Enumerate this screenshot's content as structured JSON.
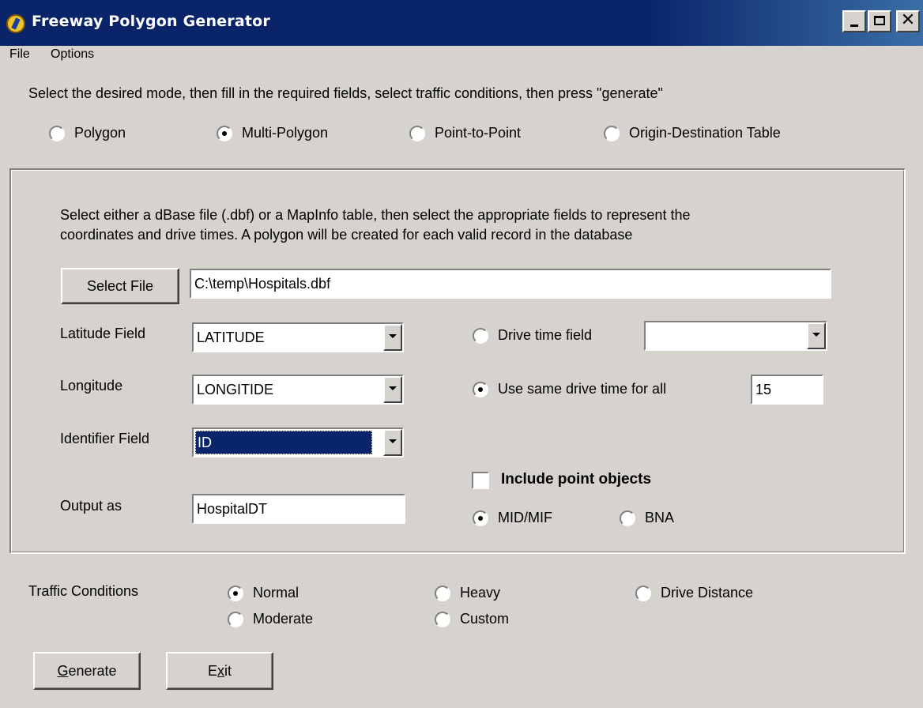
{
  "window": {
    "title": "Freeway Polygon Generator",
    "close_glyph": "✕"
  },
  "menu": [
    "File",
    "Options"
  ],
  "instruction": "Select the desired mode, then fill in the required fields, select traffic conditions, then press \"generate\"",
  "modes": [
    {
      "label": "Polygon",
      "checked": false
    },
    {
      "label": "Multi-Polygon",
      "checked": true
    },
    {
      "label": "Point-to-Point",
      "checked": false
    },
    {
      "label": "Origin-Destination Table",
      "checked": false
    }
  ],
  "panel": {
    "description_line1": "Select either a dBase file (.dbf) or a MapInfo table, then select the appropriate fields to represent the",
    "description_line2": "coordinates and drive times.  A polygon will be created for each valid record in the database",
    "select_file_label": "Select File",
    "file_path": "C:\\temp\\Hospitals.dbf",
    "latitude_label": "Latitude Field",
    "latitude_value": "LATITUDE",
    "longitude_label": "Longitude",
    "longitude_value": "LONGITIDE",
    "identifier_label": "Identifier Field",
    "identifier_value": "ID",
    "output_label": "Output as",
    "output_value": "HospitalDT",
    "drive_time_field_label": "Drive time field",
    "drive_time_field_checked": false,
    "drive_time_field_value": "",
    "same_drive_time_label": "Use same drive time for all",
    "same_drive_time_checked": true,
    "same_drive_time_value": "15",
    "include_points_label": "Include point objects",
    "include_points_checked": false,
    "format_options": [
      {
        "label": "MID/MIF",
        "checked": true
      },
      {
        "label": "BNA",
        "checked": false
      }
    ]
  },
  "traffic": {
    "label": "Traffic Conditions",
    "options": [
      {
        "label": "Normal",
        "checked": true
      },
      {
        "label": "Moderate",
        "checked": false
      },
      {
        "label": "Heavy",
        "checked": false
      },
      {
        "label": "Custom",
        "checked": false
      },
      {
        "label": "Drive Distance",
        "checked": false
      }
    ]
  },
  "buttons": {
    "generate": "Generate",
    "exit_prefix": "E",
    "exit_underlined": "x",
    "exit_suffix": "it"
  }
}
